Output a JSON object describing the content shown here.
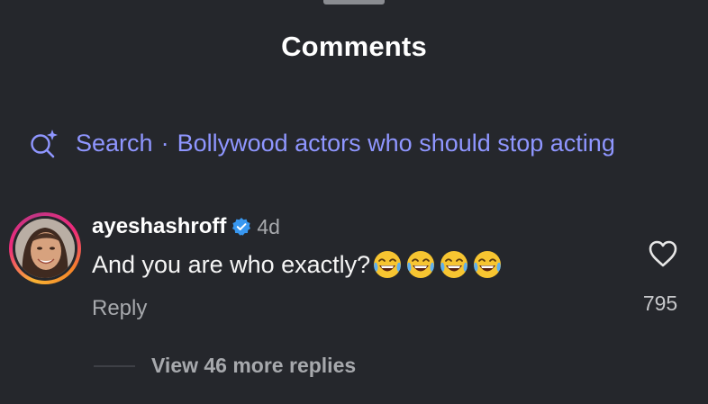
{
  "header": {
    "title": "Comments"
  },
  "search": {
    "prefix": "Search",
    "separator": "·",
    "query": "Bollywood actors who should stop acting",
    "icon": "sparkle-search-icon",
    "color": "#8f96ff"
  },
  "comment": {
    "username": "ayeshashroff",
    "verified": true,
    "time": "4d",
    "text": "And you are who exactly?",
    "emoji_icon": "face-with-tears-of-joy",
    "emoji_count": 4,
    "reply_label": "Reply",
    "like_count": "795"
  },
  "replies": {
    "label": "View 46 more replies"
  },
  "colors": {
    "background": "#25272c",
    "verified": "#3897f0",
    "muted_text": "#a7a9ad"
  }
}
